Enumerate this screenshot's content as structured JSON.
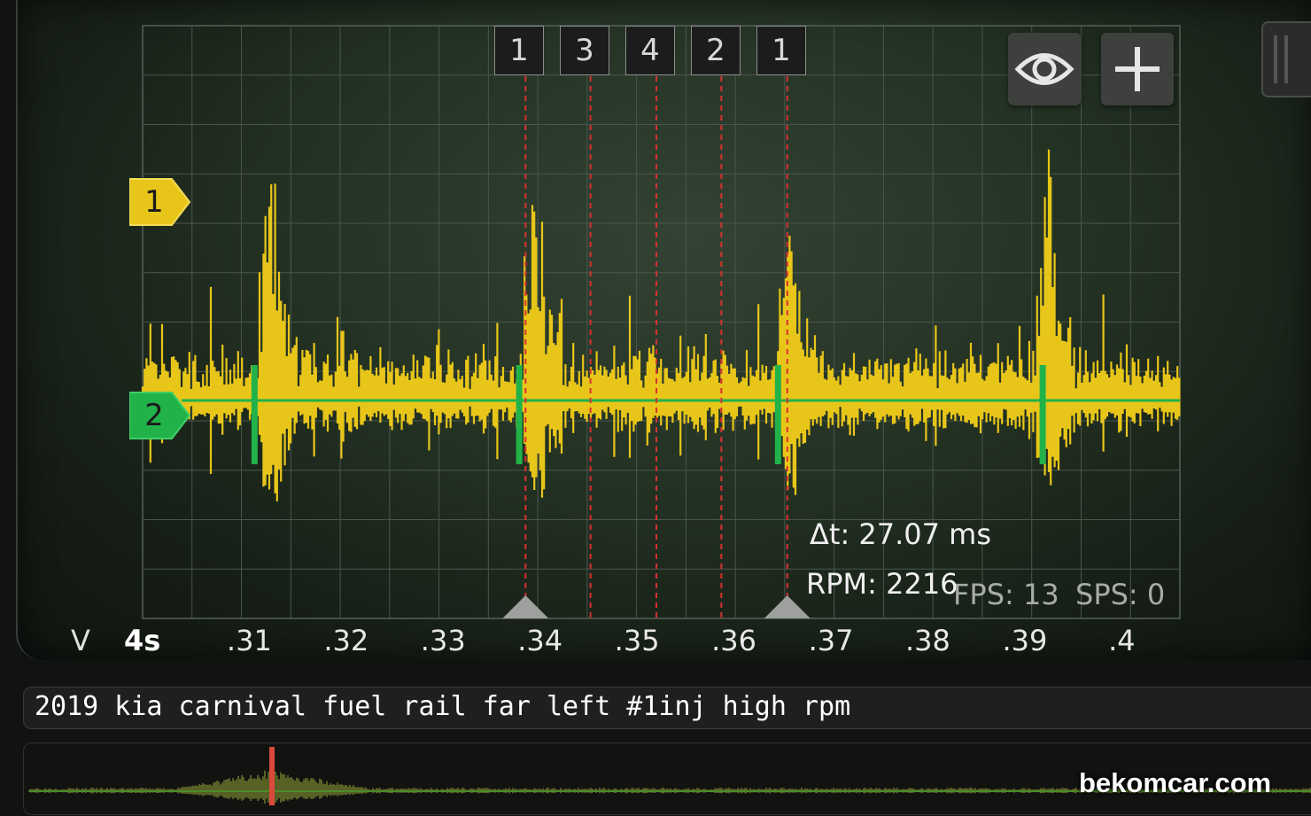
{
  "scope": {
    "unit_label": "V",
    "timebase_label": "4s",
    "x_ticks": [
      ".31",
      ".32",
      ".33",
      ".34",
      ".35",
      ".36",
      ".37",
      ".38",
      ".39",
      ".4"
    ],
    "cursor_labels": [
      "1",
      "3",
      "4",
      "2",
      "1"
    ],
    "channels": [
      {
        "label": "1",
        "color": "#e8c619"
      },
      {
        "label": "2",
        "color": "#22b24a"
      }
    ],
    "delta_t": "Δt: 27.07 ms",
    "rpm": "RPM: 2216",
    "fps": "FPS: 13",
    "sps": "SPS: 0",
    "cursor_line_color": "#d93030"
  },
  "toolbar": {
    "visibility_icon": "eye-icon",
    "add_icon": "plus-icon"
  },
  "recording": {
    "title": "2019 kia carnival fuel rail far left #1inj high rpm"
  },
  "watermark": "bekomcar.com",
  "chart_data": {
    "type": "line",
    "xlabel": "",
    "ylabel": "V",
    "x_ticks": [
      0.31,
      0.32,
      0.33,
      0.34,
      0.35,
      0.36,
      0.37,
      0.38,
      0.39,
      0.4
    ],
    "xlim": [
      0.299,
      0.406
    ],
    "series": [
      {
        "name": "1",
        "color": "#e8c619",
        "description_points": [
          [
            0.3115,
            1
          ],
          [
            0.3388,
            0.88
          ],
          [
            0.3652,
            0.82
          ],
          [
            0.3918,
            1
          ]
        ]
      },
      {
        "name": "2",
        "color": "#22b24a",
        "pulses_at": [
          0.3105,
          0.3378,
          0.3645,
          0.3918
        ]
      }
    ],
    "cursors": [
      {
        "label": "1",
        "x": 0.3385
      },
      {
        "label": "3",
        "x": 0.3452
      },
      {
        "label": "4",
        "x": 0.352
      },
      {
        "label": "2",
        "x": 0.3587
      },
      {
        "label": "1",
        "x": 0.3655
      }
    ],
    "delta_t_ms": 27.07,
    "rpm": 2216
  }
}
